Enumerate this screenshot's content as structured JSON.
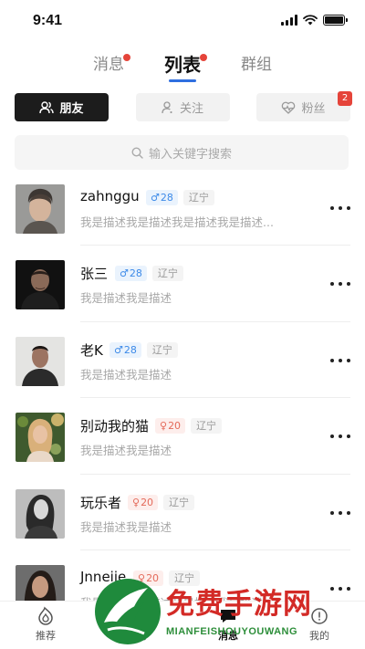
{
  "status_bar": {
    "time": "9:41"
  },
  "top_tabs": [
    {
      "label": "消息",
      "dot": true,
      "active": false
    },
    {
      "label": "列表",
      "dot": true,
      "active": true
    },
    {
      "label": "群组",
      "dot": false,
      "active": false
    }
  ],
  "segments": [
    {
      "label": "朋友",
      "icon": "users-icon",
      "active": true
    },
    {
      "label": "关注",
      "icon": "user-icon",
      "active": false
    },
    {
      "label": "粉丝",
      "icon": "heart-pulse-icon",
      "active": false,
      "badge": "2"
    }
  ],
  "search": {
    "placeholder": "输入关键字搜索"
  },
  "friends": [
    {
      "name": "zahnggu",
      "gender": "male",
      "gender_symbol": "♂",
      "age": "28",
      "region": "辽宁",
      "desc": "我是描述我是描述我是描述我是描述..."
    },
    {
      "name": "张三",
      "gender": "male",
      "gender_symbol": "♂",
      "age": "28",
      "region": "辽宁",
      "desc": "我是描述我是描述"
    },
    {
      "name": "老K",
      "gender": "male",
      "gender_symbol": "♂",
      "age": "28",
      "region": "辽宁",
      "desc": "我是描述我是描述"
    },
    {
      "name": "别动我的猫",
      "gender": "female",
      "gender_symbol": "♀",
      "age": "20",
      "region": "辽宁",
      "desc": "我是描述我是描述"
    },
    {
      "name": "玩乐者",
      "gender": "female",
      "gender_symbol": "♀",
      "age": "20",
      "region": "辽宁",
      "desc": "我是描述我是描述"
    },
    {
      "name": "Jnneiie",
      "gender": "female",
      "gender_symbol": "♀",
      "age": "20",
      "region": "辽宁",
      "desc": "我是描述我是描述我是描述我是描述"
    }
  ],
  "bottom_nav": [
    {
      "label": "推荐",
      "icon": "fire-icon",
      "active": false
    },
    {
      "label": "广场",
      "icon": "square-icon",
      "active": false
    },
    {
      "label": "消息",
      "icon": "message-icon",
      "active": true
    },
    {
      "label": "我的",
      "icon": "profile-icon",
      "active": false
    }
  ],
  "watermark": {
    "title": "免费手游网",
    "subtitle": "MIANFEISHOUYOUWANG"
  },
  "colors": {
    "accent_blue": "#2f6fe0",
    "badge_red": "#e5443a",
    "male": "#3d8ae8",
    "female": "#e46a5a"
  }
}
